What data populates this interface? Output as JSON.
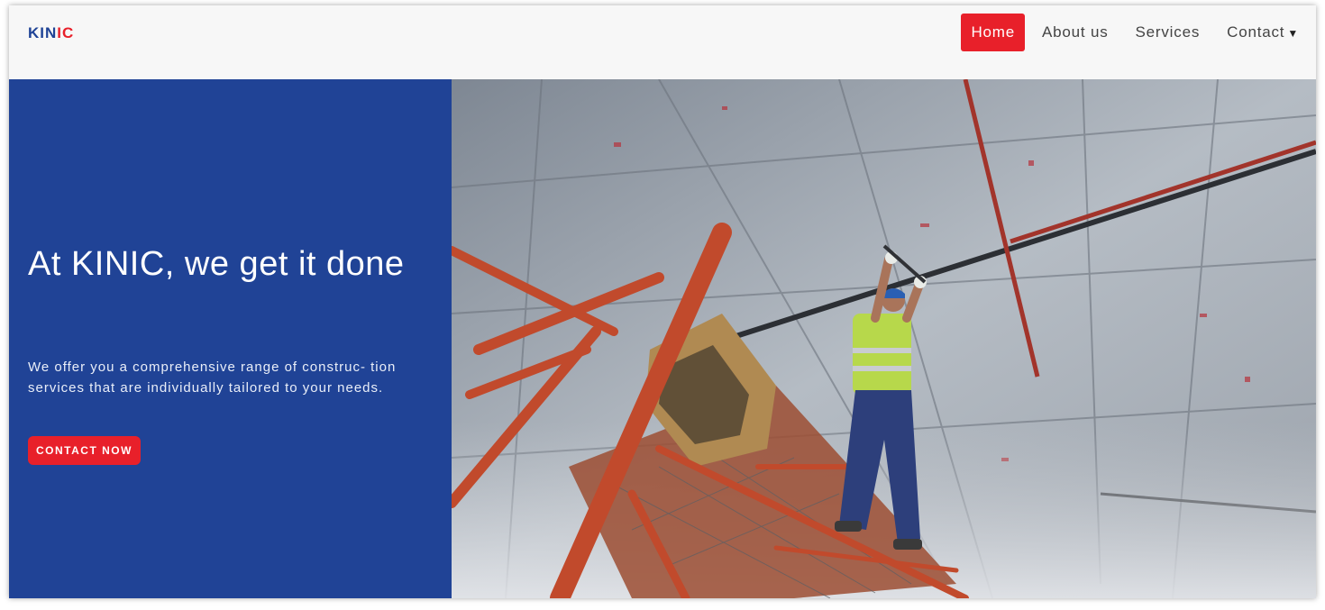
{
  "logo": {
    "part1": "KIN",
    "part2": "IC"
  },
  "nav": {
    "items": [
      {
        "label": "Home"
      },
      {
        "label": "About us"
      },
      {
        "label": "Services"
      },
      {
        "label": "Contact"
      }
    ],
    "active": "Home"
  },
  "hero": {
    "title": "At KINIC, we get it done",
    "subtitle": "We offer you a comprehensive range of construc- tion services that are individually tailored to your needs.",
    "cta_label": "CONTACT NOW",
    "image_icon": "construction-worker-photo"
  },
  "colors": {
    "brand_blue": "#204396",
    "brand_red": "#e8202a",
    "navbar_bg": "#f7f7f7"
  }
}
